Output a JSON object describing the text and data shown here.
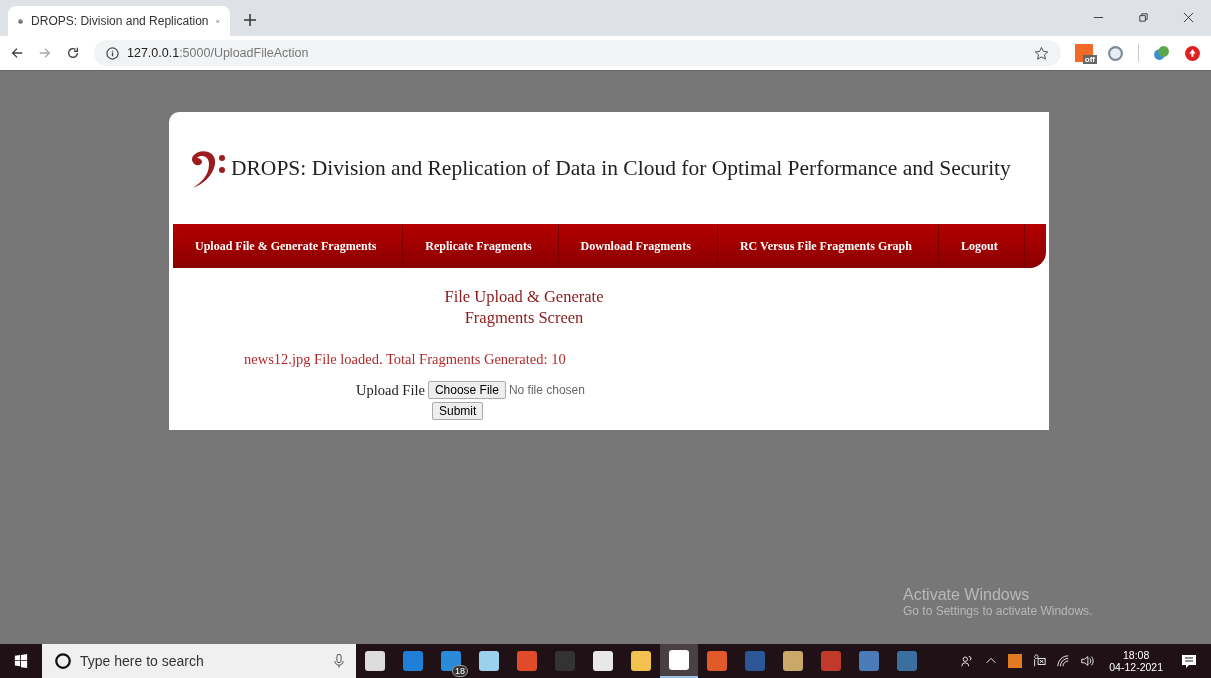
{
  "browser": {
    "tab_title": "DROPS: Division and Replication",
    "url_host": "127.0.0.1",
    "url_path": ":5000/UploadFileAction",
    "extension_badge": "off"
  },
  "page": {
    "title": "DROPS: Division and Replication of Data in Cloud for Optimal Performance and Security",
    "nav": [
      "Upload File & Generate Fragments",
      "Replicate Fragments",
      "Download Fragments",
      "RC Versus File Fragments Graph",
      "Logout"
    ],
    "heading": "File Upload & Generate Fragments Screen",
    "message": "news12.jpg File loaded. Total Fragments Generated: 10",
    "upload_label": "Upload File",
    "choose_button": "Choose File",
    "file_status": "No file chosen",
    "submit": "Submit"
  },
  "activation": {
    "title": "Activate Windows",
    "subtitle": "Go to Settings to activate Windows."
  },
  "taskbar": {
    "search_placeholder": "Type here to search",
    "apps": [
      {
        "selected": false
      },
      {
        "selected": false
      },
      {
        "selected": false,
        "badge": "18"
      },
      {
        "selected": false
      },
      {
        "selected": false
      },
      {
        "selected": false
      },
      {
        "selected": false
      },
      {
        "selected": false
      },
      {
        "selected": true
      },
      {
        "selected": false
      },
      {
        "selected": false
      },
      {
        "selected": false
      },
      {
        "selected": false
      },
      {
        "selected": false
      },
      {
        "selected": false
      }
    ],
    "time": "18:08",
    "date": "04-12-2021"
  }
}
